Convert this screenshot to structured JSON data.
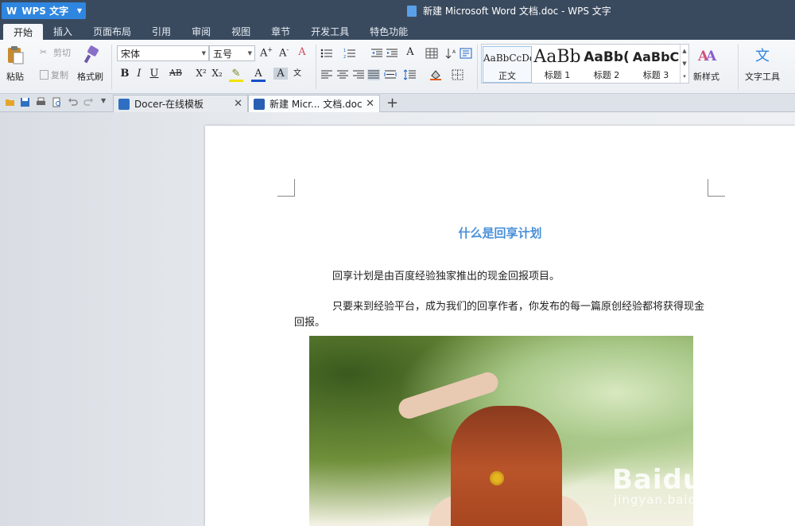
{
  "app": {
    "menu_label": "WPS 文字",
    "window_title": "新建 Microsoft Word 文档.doc - WPS 文字"
  },
  "menu_tabs": [
    {
      "label": "开始",
      "active": true
    },
    {
      "label": "插入"
    },
    {
      "label": "页面布局"
    },
    {
      "label": "引用"
    },
    {
      "label": "审阅"
    },
    {
      "label": "视图"
    },
    {
      "label": "章节"
    },
    {
      "label": "开发工具"
    },
    {
      "label": "特色功能"
    }
  ],
  "ribbon": {
    "paste": "粘贴",
    "cut": "剪切",
    "copy": "复制",
    "format_painter": "格式刷",
    "font_name": "宋体",
    "font_size": "五号",
    "styles": [
      {
        "preview": "AaBbCcDd",
        "label": "正文"
      },
      {
        "preview": "AaBb",
        "label": "标题 1"
      },
      {
        "preview": "AaBb(",
        "label": "标题 2"
      },
      {
        "preview": "AaBbC",
        "label": "标题 3"
      }
    ],
    "new_style": "新样式",
    "text_tools": "文字工具"
  },
  "tabs": {
    "docer": "Docer-在线模板",
    "current": "新建 Micr... 文档.doc"
  },
  "document": {
    "title": "什么是回享计划",
    "para1": "回享计划是由百度经验独家推出的现金回报项目。",
    "para2": "只要来到经验平台，成为我们的回享作者，你发布的每一篇原创经验都将获得现金回报。"
  },
  "watermark": {
    "logo": "Baidu经验",
    "url": "jingyan.baidu.com"
  },
  "colors": {
    "title_bar": "#3a4a5e",
    "accent": "#2f86e0",
    "doc_title": "#4a90d9"
  }
}
